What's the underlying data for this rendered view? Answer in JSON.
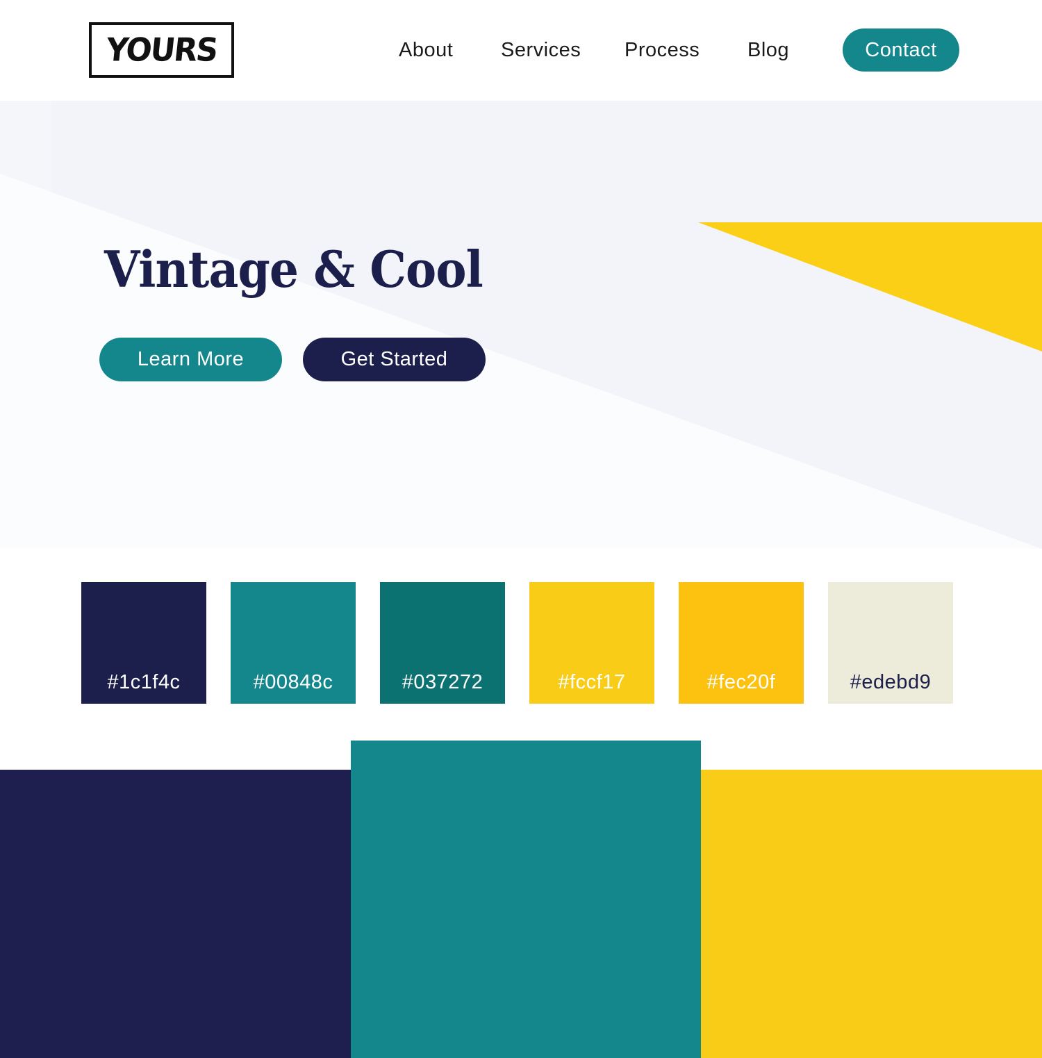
{
  "header": {
    "logo_text": "YOURS",
    "nav": [
      {
        "label": "About"
      },
      {
        "label": "Services"
      },
      {
        "label": "Process"
      },
      {
        "label": "Blog"
      }
    ],
    "contact_label": "Contact"
  },
  "hero": {
    "title": "Vintage & Cool",
    "learn_more_label": "Learn More",
    "get_started_label": "Get Started",
    "accent_color": "#fccf17"
  },
  "palette": {
    "swatches": [
      {
        "label": "#1c1f4c",
        "color": "#1c1f4c",
        "text_color": "#ffffff"
      },
      {
        "label": "#00848c",
        "color": "#14878d",
        "text_color": "#ffffff"
      },
      {
        "label": "#037272",
        "color": "#0c7171",
        "text_color": "#ffffff"
      },
      {
        "label": "#fccf17",
        "color": "#f9cd17",
        "text_color": "#ffffff"
      },
      {
        "label": "#fec20f",
        "color": "#fdc210",
        "text_color": "#ffffff"
      },
      {
        "label": "#edebd9",
        "color": "#edebda",
        "text_color": "#1c1f4c"
      }
    ]
  },
  "color_blocks": [
    {
      "name": "navy",
      "color": "#1e1f4f"
    },
    {
      "name": "teal",
      "color": "#14878d"
    },
    {
      "name": "yellow",
      "color": "#f9cd17"
    }
  ]
}
